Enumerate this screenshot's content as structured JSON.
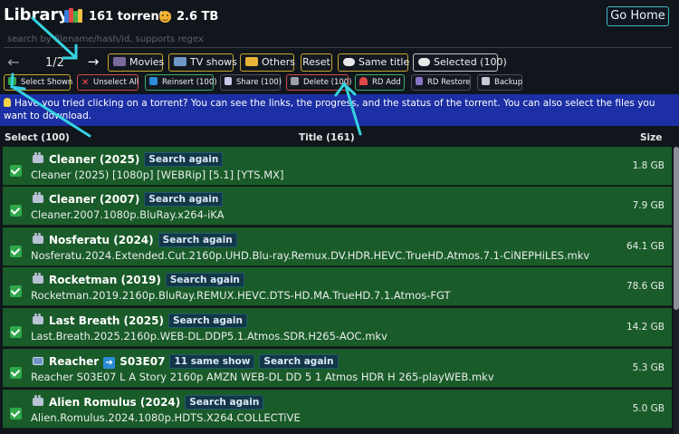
{
  "header": {
    "title": "Library",
    "torrent_count": "161 torrents",
    "total_size": "2.6 TB",
    "go_home_label": "Go Home"
  },
  "search": {
    "placeholder": "search by filename/hash/id, supports regex"
  },
  "pager": {
    "text": "1/2"
  },
  "filters": {
    "movies": "Movies",
    "tv_shows": "TV shows",
    "others": "Others",
    "reset": "Reset",
    "same_title": "Same title",
    "selected": "Selected (100)"
  },
  "actions": {
    "select_shown": "Select Shown",
    "unselect_all": "Unselect All",
    "reinsert": "Reinsert (100)",
    "share": "Share (100)",
    "delete": "Delete (100)",
    "rd_add": "RD Add",
    "rd_restore": "RD Restore",
    "backup": "Backup"
  },
  "info_banner": "Have you tried clicking on a torrent? You can see the links, the progress, and the status of the torrent. You can also select the files you want to download.",
  "table": {
    "col_select": "Select (100)",
    "col_title": "Title (161)",
    "col_size": "Size"
  },
  "rows": [
    {
      "title": "Cleaner (2025)",
      "tag": "Search again",
      "file": "Cleaner (2025) [1080p] [WEBRip] [5.1] [YTS.MX]",
      "size": "1.8 GB",
      "icon": "movie-camera-icon"
    },
    {
      "title": "Cleaner (2007)",
      "tag": "Search again",
      "file": "Cleaner.2007.1080p.BluRay.x264-iKA",
      "size": "7.9 GB",
      "icon": "movie-camera-icon"
    },
    {
      "title": "Nosferatu (2024)",
      "tag": "Search again",
      "file": "Nosferatu.2024.Extended.Cut.2160p.UHD.Blu-ray.Remux.DV.HDR.HEVC.TrueHD.Atmos.7.1-CiNEPHiLES.mkv",
      "size": "64.1 GB",
      "icon": "movie-camera-icon"
    },
    {
      "title": "Rocketman (2019)",
      "tag": "Search again",
      "file": "Rocketman.2019.2160p.BluRay.REMUX.HEVC.DTS-HD.MA.TrueHD.7.1.Atmos-FGT",
      "size": "78.6 GB",
      "icon": "movie-camera-icon"
    },
    {
      "title": "Last Breath (2025)",
      "tag": "Search again",
      "file": "Last.Breath.2025.2160p.WEB-DL.DDP5.1.Atmos.SDR.H265-AOC.mkv",
      "size": "14.2 GB",
      "icon": "movie-camera-icon"
    },
    {
      "title": "Reacher",
      "episode": "S03E07",
      "tag_extra": "11 same show",
      "tag": "Search again",
      "file": "Reacher S03E07 L A Story 2160p AMZN WEB-DL DD 5 1 Atmos HDR H 265-playWEB.mkv",
      "size": "5.3 GB",
      "icon": "tv-icon"
    },
    {
      "title": "Alien Romulus (2024)",
      "tag": "Search again",
      "file": "Alien.Romulus.2024.1080p.HDTS.X264.COLLECTiVE",
      "size": "5.0 GB",
      "icon": "movie-camera-icon"
    }
  ],
  "colors": {
    "background": "#11151c",
    "row_selected": "#1a5b2a",
    "info_banner": "#1c2fa4",
    "accent_cyan": "#3fb8c4",
    "filter_border": "#c9a72a"
  }
}
